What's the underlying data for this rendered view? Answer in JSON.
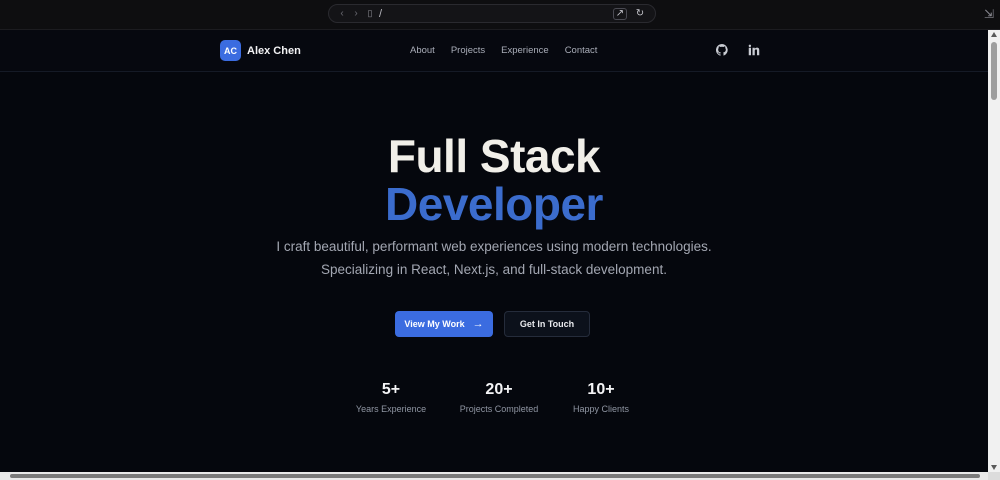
{
  "browser": {
    "back_icon": "chevron-left",
    "forward_icon": "chevron-right",
    "page_icon": "page",
    "url": "/",
    "open_in_icon": "external-link",
    "reload_icon": "reload",
    "collapse_icon": "collapse"
  },
  "nav": {
    "logo_initials": "AC",
    "logo_name": "Alex Chen",
    "links": [
      "About",
      "Projects",
      "Experience",
      "Contact"
    ],
    "github_icon": "github",
    "linkedin_icon": "linkedin"
  },
  "hero": {
    "title_line1": "Full Stack",
    "title_line2": "Developer",
    "subtitle_line1": "I craft beautiful, performant web experiences using modern technologies.",
    "subtitle_line2": "Specializing in React, Next.js, and full-stack development.",
    "primary_button": "View My Work",
    "primary_button_icon": "→",
    "secondary_button": "Get In Touch"
  },
  "stats": [
    {
      "value": "5+",
      "label": "Years Experience"
    },
    {
      "value": "20+",
      "label": "Projects Completed"
    },
    {
      "value": "10+",
      "label": "Happy Clients"
    }
  ],
  "colors": {
    "accent": "#3b6ce0",
    "background": "#05070d",
    "title": "#f1efe9"
  }
}
